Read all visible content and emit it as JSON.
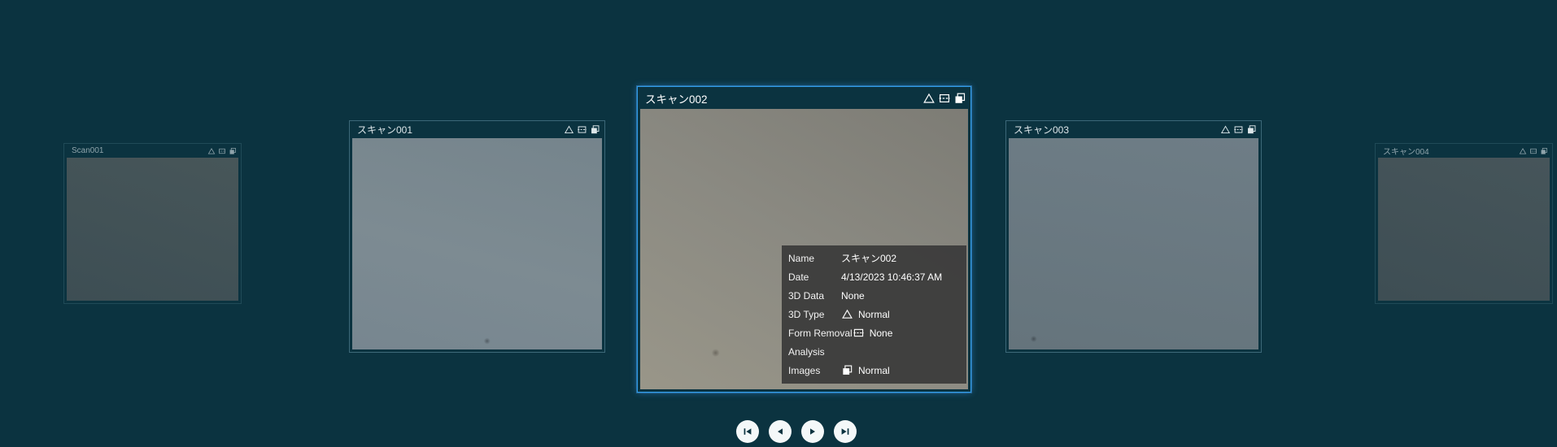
{
  "colors": {
    "background": "#0b3340",
    "selection_accent": "#2f9ce8",
    "info_panel_bg": "#3a3a3a"
  },
  "cards": [
    {
      "title": "Scan001",
      "state": "dimmed"
    },
    {
      "title": "スキャン001",
      "state": "normal"
    },
    {
      "title": "スキャン002",
      "state": "selected"
    },
    {
      "title": "スキャン003",
      "state": "normal"
    },
    {
      "title": "スキャン004",
      "state": "dimmed"
    }
  ],
  "card_status_icons": [
    "3d-type-triangle",
    "form-removal",
    "images"
  ],
  "info_panel": {
    "rows": [
      {
        "label": "Name",
        "value": "スキャン002"
      },
      {
        "label": "Date",
        "value": "4/13/2023 10:46:37 AM"
      },
      {
        "label": "3D Data",
        "value": "None"
      },
      {
        "label": "3D Type",
        "value": "Normal",
        "icon": "triangle-icon"
      },
      {
        "label": "Form Removal",
        "value": "None",
        "icon": "form-removal-icon"
      },
      {
        "label": "Analysis",
        "value": ""
      },
      {
        "label": "Images",
        "value": "Normal",
        "icon": "images-icon"
      }
    ]
  },
  "nav": {
    "first_label": "First",
    "prev_label": "Previous",
    "next_label": "Next",
    "last_label": "Last"
  }
}
